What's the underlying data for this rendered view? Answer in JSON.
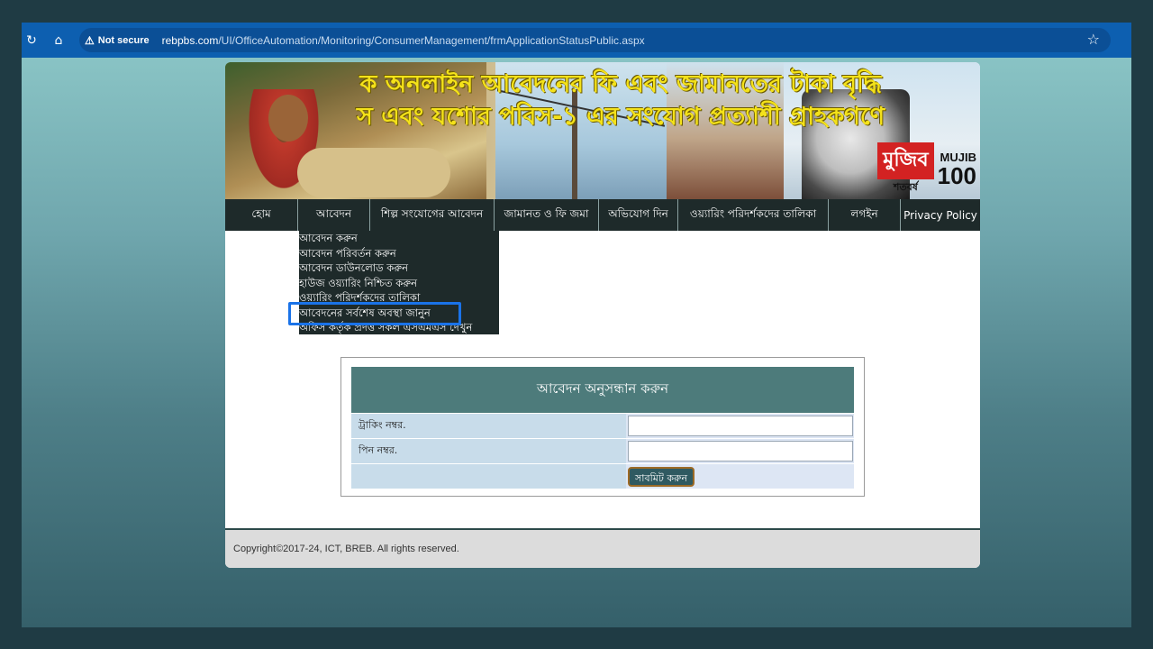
{
  "browser": {
    "security_label": "Not secure",
    "url_host": "rebpbs.com",
    "url_path": "/UI/OfficeAutomation/Monitoring/ConsumerManagement/frmApplicationStatusPublic.aspx"
  },
  "banner": {
    "headline_1": "ক অনলাইন আবেদনের ফি এবং জামানতের টাকা বৃদ্ধি",
    "headline_2": "স এবং যশোর পবিস-১ এর সংযোগ প্রত্যাশী গ্রাহকগণে",
    "badge_bn": "মুজিব",
    "badge_en_top": "MUJIB",
    "badge_en_num": "100",
    "badge_sub": "শতবর্ষ"
  },
  "nav": {
    "items": [
      {
        "label": "হোম"
      },
      {
        "label": "আবেদন"
      },
      {
        "label": "শিল্প সংযোগের আবেদন"
      },
      {
        "label": "জামানত ও ফি জমা"
      },
      {
        "label": "অভিযোগ দিন"
      },
      {
        "label": "ওয়্যারিং পরিদর্শকদের তালিকা"
      },
      {
        "label": "লগইন"
      },
      {
        "label": "Privacy Policy"
      }
    ]
  },
  "dropdown": {
    "items": [
      {
        "label": "আবেদন করুন"
      },
      {
        "label": "আবেদন পরিবর্তন করুন"
      },
      {
        "label": "আবেদন ডাউনলোড করুন"
      },
      {
        "label": "হাউজ ওয়্যারিং নিশ্চিত করুন"
      },
      {
        "label": "ওয়্যারিং পরিদর্শকদের তালিকা"
      },
      {
        "label": "আবেদনের সর্বশেষ অবস্থা জানুন"
      },
      {
        "label": "অফিস কর্তৃক প্রদত্ত সকল এসএমএস দেখুন"
      }
    ]
  },
  "form": {
    "title": "আবেদন অনুসন্ধান করুন",
    "tracking_label": "ট্রাকিং নম্বর.",
    "tracking_value": "",
    "pin_label": "পিন নম্বর.",
    "pin_value": "",
    "submit_label": "সাবমিট করুন"
  },
  "footer": {
    "copyright": "Copyright©2017-24, ICT, BREB. All rights reserved."
  },
  "colors": {
    "browser_bar": "#0d5fb0",
    "nav_bg": "#1e2a2a",
    "form_header": "#4d7b7b",
    "highlight": "#1a73e8",
    "headline": "#f4e21a"
  }
}
